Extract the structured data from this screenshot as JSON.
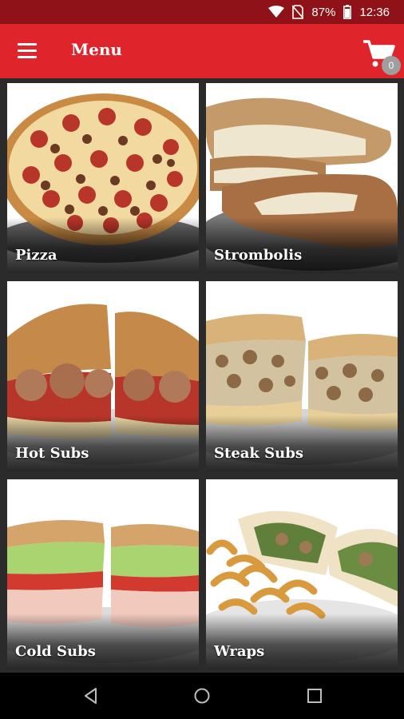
{
  "status_bar": {
    "battery": "87%",
    "time": "12:36",
    "icons": [
      "wifi-icon",
      "no-sim-icon",
      "battery-icon"
    ]
  },
  "app_bar": {
    "title": "Menu",
    "menu_icon": "hamburger-icon",
    "cart_icon": "cart-icon",
    "cart_count": "0",
    "color": "#e0242b"
  },
  "categories": [
    {
      "label": "Pizza"
    },
    {
      "label": "Strombolis"
    },
    {
      "label": "Hot Subs"
    },
    {
      "label": "Steak Subs"
    },
    {
      "label": "Cold Subs"
    },
    {
      "label": "Wraps"
    }
  ],
  "nav_bar": {
    "icons": [
      "back-icon",
      "home-icon",
      "recents-icon"
    ]
  }
}
